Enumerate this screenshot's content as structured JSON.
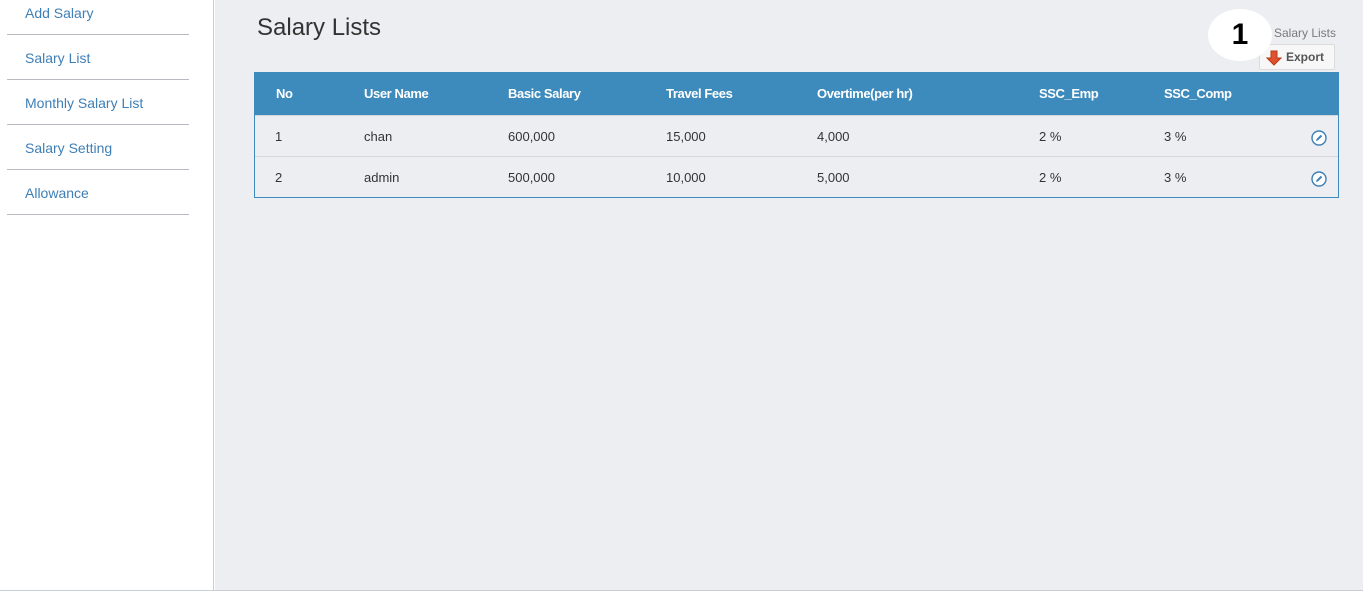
{
  "sidebar": {
    "items": [
      {
        "label": "Add Salary"
      },
      {
        "label": "Salary List"
      },
      {
        "label": "Monthly Salary List"
      },
      {
        "label": "Salary Setting"
      },
      {
        "label": "Allowance"
      }
    ]
  },
  "main": {
    "title": "Salary Lists",
    "breadcrumb": "Salary Lists",
    "export_label": "Export",
    "badge": "1"
  },
  "table": {
    "headers": [
      "No",
      "User Name",
      "Basic Salary",
      "Travel Fees",
      "Overtime(per hr)",
      "SSC_Emp",
      "SSC_Comp"
    ],
    "rows": [
      [
        "1",
        "chan",
        "600,000",
        "15,000",
        "4,000",
        "2 %",
        "3 %"
      ],
      [
        "2",
        "admin",
        "500,000",
        "10,000",
        "5,000",
        "2 %",
        "3 %"
      ]
    ]
  },
  "colors": {
    "header_bg": "#3d8bbd",
    "link": "#3d7fb6",
    "export_icon": "#e0522b"
  },
  "icons": {
    "export": "arrow-down-icon",
    "edit": "pencil-circle-icon"
  }
}
